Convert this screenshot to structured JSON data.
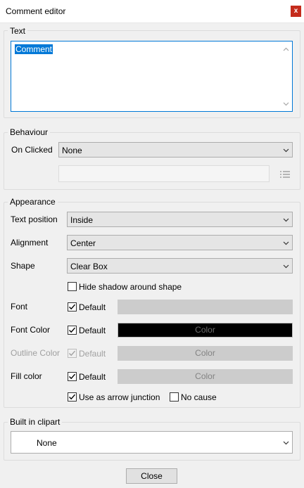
{
  "window": {
    "title": "Comment editor",
    "close_glyph": "x"
  },
  "text_group": {
    "legend": "Text",
    "value": "Comment"
  },
  "behaviour": {
    "legend": "Behaviour",
    "on_clicked_label": "On Clicked",
    "on_clicked_value": "None"
  },
  "appearance": {
    "legend": "Appearance",
    "text_position_label": "Text position",
    "text_position_value": "Inside",
    "alignment_label": "Alignment",
    "alignment_value": "Center",
    "shape_label": "Shape",
    "shape_value": "Clear Box",
    "hide_shadow_label": "Hide shadow around shape",
    "hide_shadow_checked": false,
    "font_label": "Font",
    "font_default_label": "Default",
    "font_default_checked": true,
    "font_color_label": "Font Color",
    "font_color_default_label": "Default",
    "font_color_default_checked": true,
    "font_color_button": "Color",
    "font_color_swatch": "#000000",
    "outline_color_label": "Outline Color",
    "outline_color_default_label": "Default",
    "outline_color_default_checked": true,
    "outline_color_button": "Color",
    "fill_color_label": "Fill color",
    "fill_color_default_label": "Default",
    "fill_color_default_checked": true,
    "fill_color_button": "Color",
    "arrow_junction_label": "Use as arrow junction",
    "arrow_junction_checked": true,
    "no_cause_label": "No cause",
    "no_cause_checked": false
  },
  "clipart": {
    "legend": "Built in clipart",
    "value": "None"
  },
  "footer": {
    "close_label": "Close"
  },
  "colors": {
    "accent": "#0078d7",
    "title_close": "#c42b1c"
  }
}
